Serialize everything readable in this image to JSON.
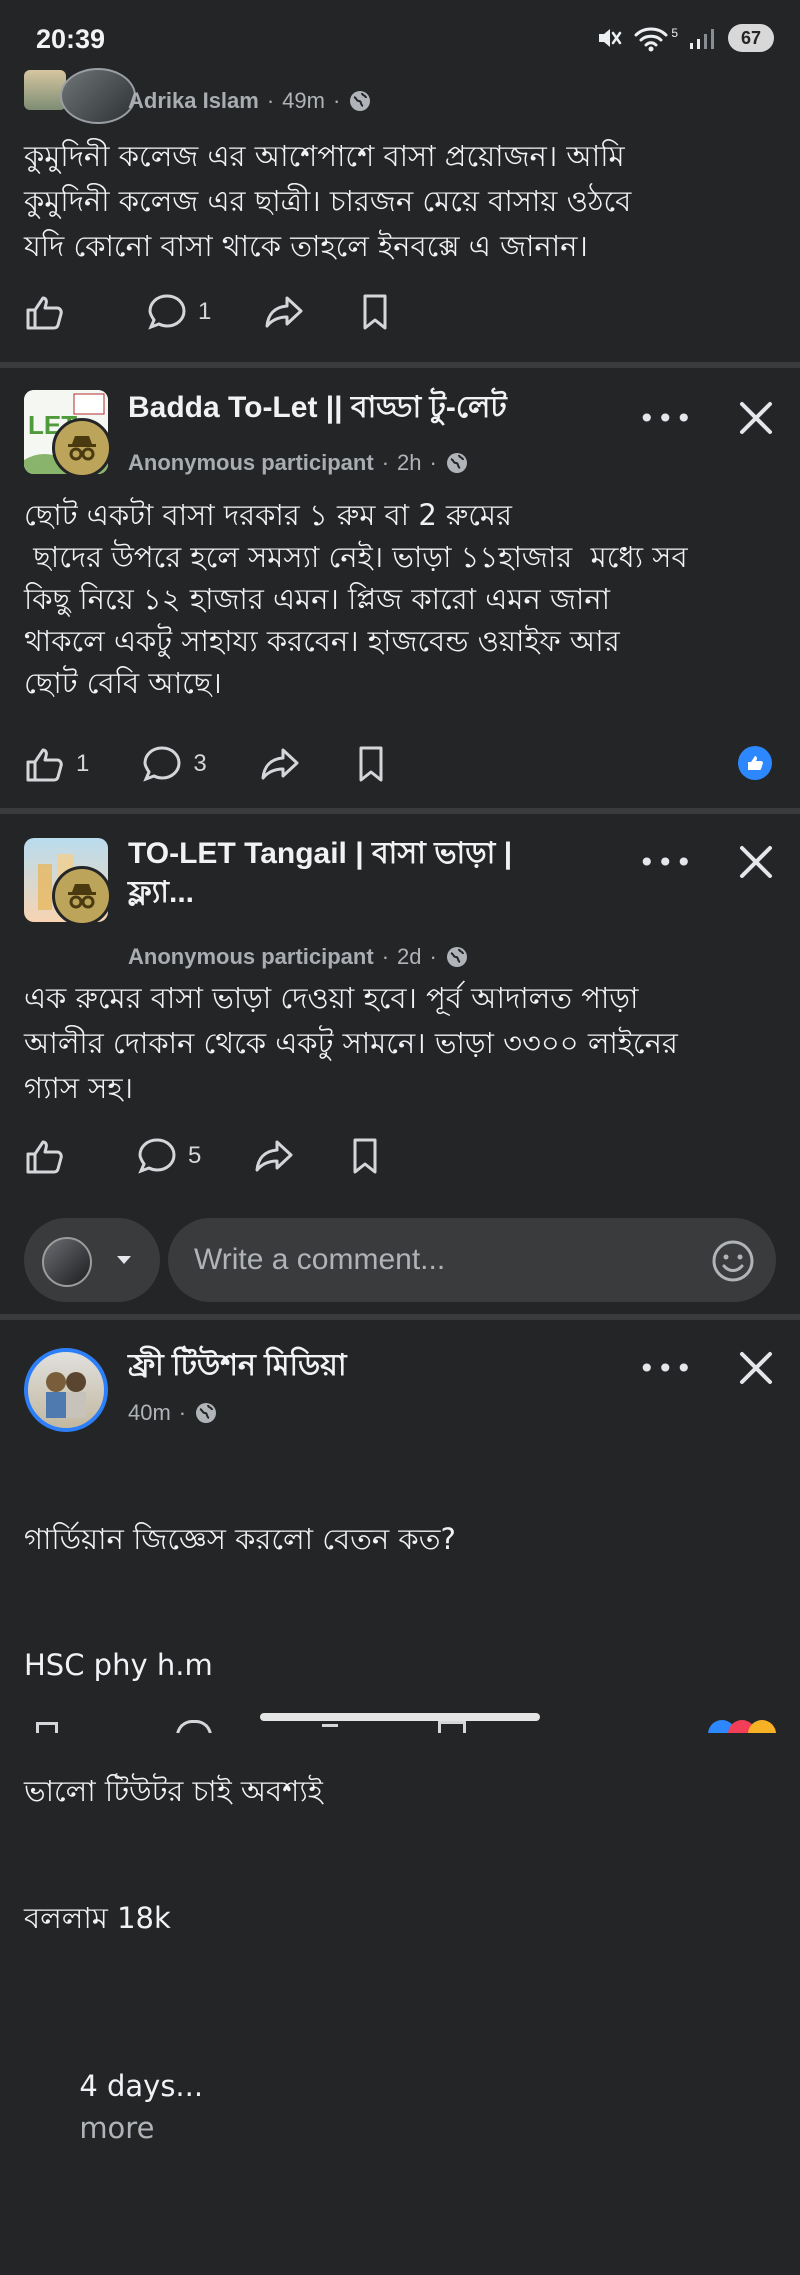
{
  "status": {
    "time": "20:39",
    "battery": "67",
    "wifi_label": "5"
  },
  "posts": [
    {
      "author": "Adrika Islam",
      "meta_time": "49m",
      "body": "কুমুদিনী কলেজ এর আশেপাশে বাসা প্রয়োজন। আমি\nকুমুদিনী কলেজ এর ছাত্রী। চারজন মেয়ে বাসায় ওঠবে\nযদি কোনো বাসা থাকে তাহলে ইনবক্সে এ জানান।",
      "like_count": "",
      "comment_count": "1"
    },
    {
      "group": "Badda To-Let || বাড্ডা টু-লেট",
      "author": "Anonymous participant",
      "meta_time": "2h",
      "body": "ছোট একটা বাসা দরকার ১ রুম বা 2 রুমের\n ছাদের উপরে হলে সমস্যা নেই। ভাড়া ১১হাজার  মধ্যে সব\nকিছু নিয়ে ১২ হাজার এমন। প্লিজ কারো এমন জানা\nথাকলে একটু সাহায্য করবেন। হাজবেন্ড ওয়াইফ আর\nছোট বেবি আছে।",
      "like_count": "1",
      "comment_count": "3"
    },
    {
      "group": "TO-LET Tangail | বাসা ভাড়া |\nফ্ল্যা...",
      "author": "Anonymous participant",
      "meta_time": "2d",
      "body": "এক রুমের বাসা ভাড়া দেওয়া হবে। পূর্ব আদালত পাড়া\nআলীর দোকান থেকে একটু সামনে। ভাড়া ৩৩০০ লাইনের\nগ্যাস সহ।",
      "comment_count": "5",
      "comment_placeholder": "Write a comment..."
    },
    {
      "author": "ফ্রী টিউশন মিডিয়া",
      "meta_time": "40m",
      "body_lines": [
        "গার্ডিয়ান জিজ্ঞেস করলো বেতন কত?",
        "HSC phy h.m",
        "ভালো টিউটর চাই অবশ্যই",
        "বললাম 18k",
        "4 days..."
      ],
      "more_label": "more"
    }
  ]
}
